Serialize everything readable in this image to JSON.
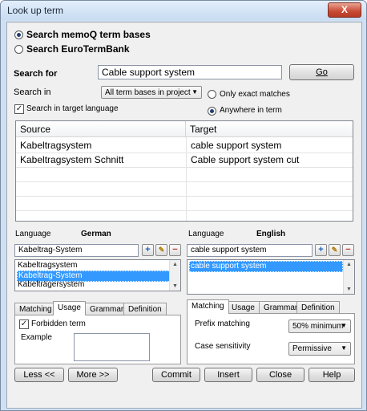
{
  "window": {
    "title": "Look up term",
    "close": "X"
  },
  "search_mode": {
    "memoq": "Search memoQ term bases",
    "eurotermbank": "Search EuroTermBank"
  },
  "search": {
    "for_label": "Search for",
    "query": "Cable support system",
    "go": "Go",
    "in_label": "Search in",
    "in_value": "All term bases in project",
    "target_lang_check": "Search in target language",
    "exact": "Only exact matches",
    "anywhere": "Anywhere in term"
  },
  "results": {
    "columns": [
      "Source",
      "Target"
    ],
    "rows": [
      {
        "source": "Kabeltragsystem",
        "target": "cable support system"
      },
      {
        "source": "Kabeltragsystem Schnitt",
        "target": "Cable support system cut"
      }
    ]
  },
  "left_pane": {
    "language_label": "Language",
    "language": "German",
    "term": "Kabeltrag-System",
    "entries": [
      "Kabeltragsystem",
      "Kabeltrag-System",
      "Kabelträgersystem"
    ],
    "tabs": [
      "Matching",
      "Usage",
      "Grammar",
      "Definition"
    ],
    "forbidden": "Forbidden term",
    "example": "Example"
  },
  "right_pane": {
    "language_label": "Language",
    "language": "English",
    "term": "cable support system",
    "entries": [
      "cable support system"
    ],
    "tabs": [
      "Matching",
      "Usage",
      "Grammar",
      "Definition"
    ],
    "prefix_label": "Prefix matching",
    "prefix_value": "50% minimum",
    "case_label": "Case sensitivity",
    "case_value": "Permissive"
  },
  "buttons": {
    "less": "Less <<",
    "more": "More >>",
    "commit": "Commit",
    "insert": "Insert",
    "close": "Close",
    "help": "Help"
  }
}
